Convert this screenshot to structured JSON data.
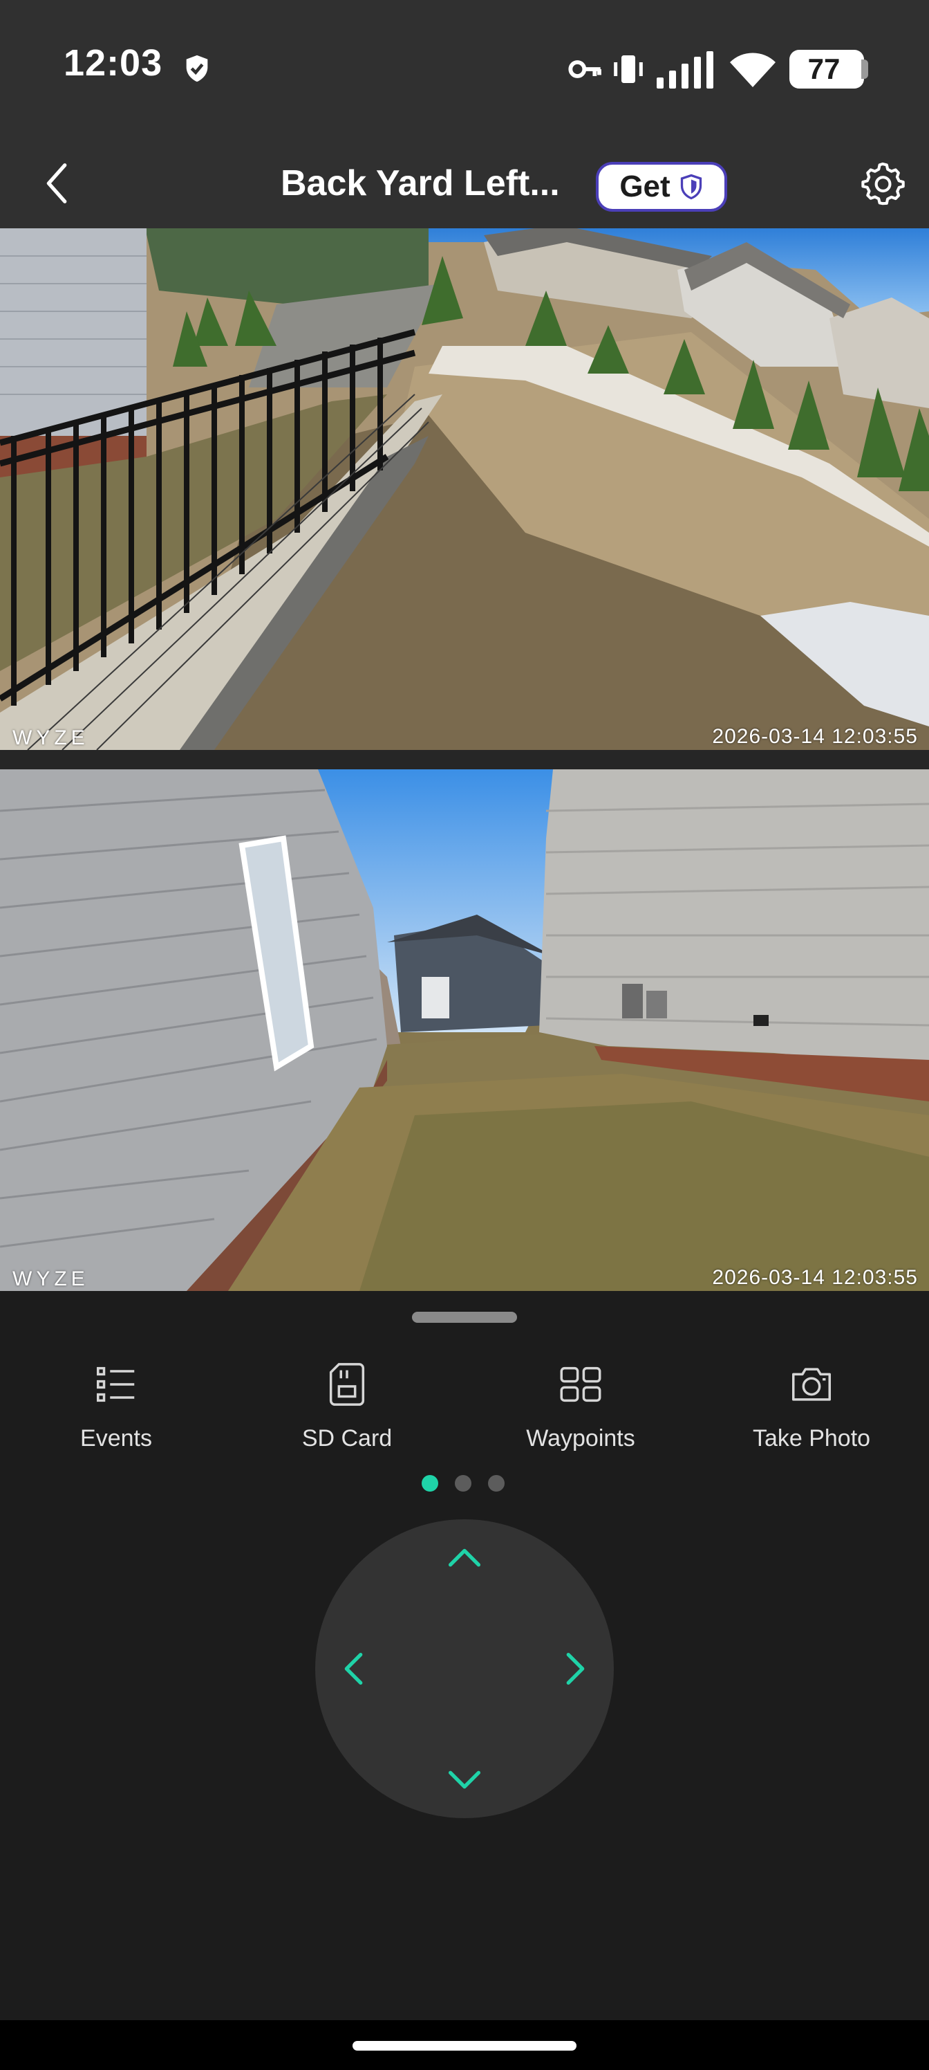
{
  "status_bar": {
    "time": "12:03",
    "battery": "77",
    "icons": [
      "shield-check-icon",
      "key-icon",
      "vibrate-icon",
      "cell-signal-icon",
      "wifi-icon",
      "battery-icon"
    ]
  },
  "header": {
    "title": "Back Yard Left...",
    "get_label": "Get",
    "back_icon": "chevron-left-icon",
    "settings_icon": "gear-icon"
  },
  "feeds": [
    {
      "logo": "WYZE",
      "timestamp": "2026-03-14  12:03:55"
    },
    {
      "logo": "WYZE",
      "timestamp": "2026-03-14  12:03:55"
    }
  ],
  "actions": [
    {
      "label": "Events",
      "icon": "list-icon"
    },
    {
      "label": "SD Card",
      "icon": "sd-card-icon"
    },
    {
      "label": "Waypoints",
      "icon": "grid-icon"
    },
    {
      "label": "Take Photo",
      "icon": "camera-icon"
    }
  ],
  "pager": {
    "active_index": 0,
    "count": 3
  },
  "dpad": {
    "accent": "#1fd3a8"
  },
  "colors": {
    "accent": "#1fd3a8",
    "background": "#1c1c1c",
    "header": "#303030",
    "get_border": "#4b3fb8"
  }
}
